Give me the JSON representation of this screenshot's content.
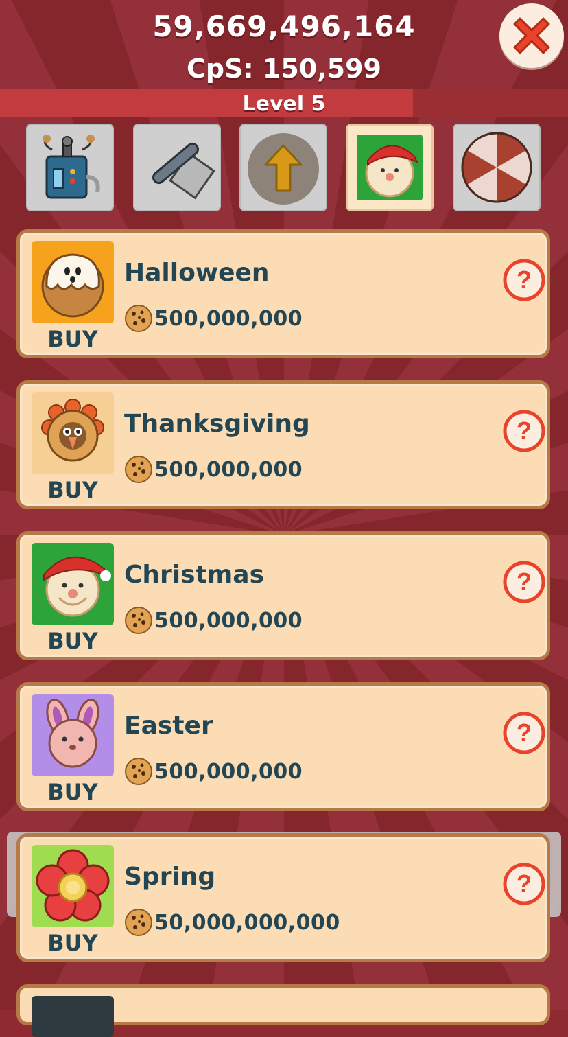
{
  "header": {
    "cookie_total": "59,669,496,164",
    "cps": "CpS: 150,599",
    "level": "Level 5"
  },
  "tabs": [
    {
      "icon": "telephone-machine-icon",
      "active": false
    },
    {
      "icon": "rolling-pin-icon",
      "active": false
    },
    {
      "icon": "upgrade-arrow-icon",
      "active": false
    },
    {
      "icon": "santa-cookie-icon",
      "active": true
    },
    {
      "icon": "peppermint-candy-icon",
      "active": false
    }
  ],
  "items": [
    {
      "name": "Halloween",
      "price": "500,000,000",
      "buy": "BUY",
      "icon": "ghost-cookie-icon",
      "bg": "#f7a21d"
    },
    {
      "name": "Thanksgiving",
      "price": "500,000,000",
      "buy": "BUY",
      "icon": "turkey-cookie-icon",
      "bg": "#f6cf95"
    },
    {
      "name": "Christmas",
      "price": "500,000,000",
      "buy": "BUY",
      "icon": "santa-cookie-icon",
      "bg": "#2da43a"
    },
    {
      "name": "Easter",
      "price": "500,000,000",
      "buy": "BUY",
      "icon": "bunny-cookie-icon",
      "bg": "#b28ee8"
    },
    {
      "name": "Spring",
      "price": "50,000,000,000",
      "buy": "BUY",
      "icon": "flower-cookie-icon",
      "bg": "#9fdc4f"
    }
  ],
  "colors": {
    "text": "#234655",
    "card": "#fbdcb4",
    "card_border": "#b77a47",
    "background": "#8e2a30",
    "close_red": "#e8442c"
  }
}
